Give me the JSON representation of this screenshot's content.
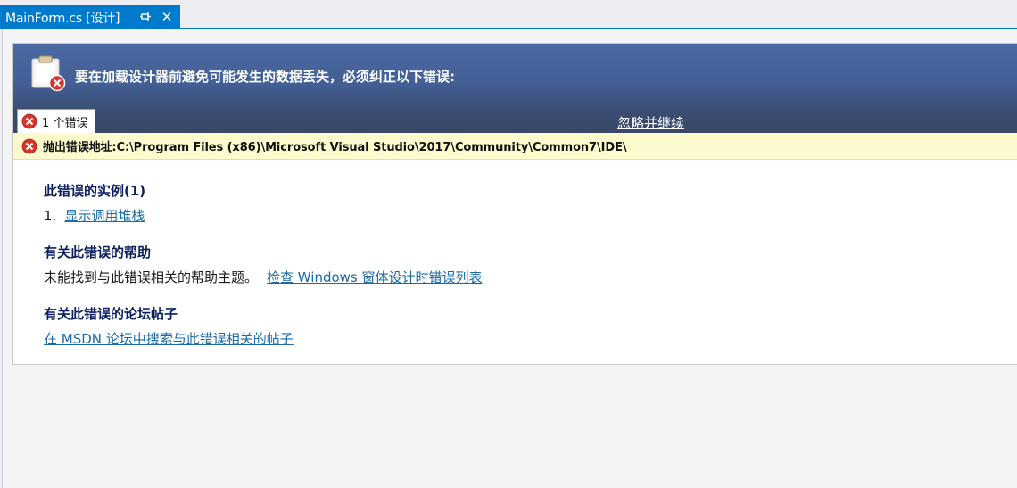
{
  "tab": {
    "title": "MainForm.cs [设计]",
    "pin_icon": "pin-icon",
    "close_label": "✕"
  },
  "header": {
    "message": "要在加载设计器前避免可能发生的数据丢失，必须纠正以下错误:",
    "icon": "clipboard-error-icon"
  },
  "error_tab": {
    "label": "1 个错误",
    "icon": "error-icon"
  },
  "ignore_link": "忽略并继续",
  "error_bar": {
    "text": "抛出错误地址:C:\\Program Files (x86)\\Microsoft Visual Studio\\2017\\Community\\Common7\\IDE\\",
    "icon": "error-icon"
  },
  "sections": {
    "instances": {
      "heading": "此错误的实例(1)",
      "number": "1.",
      "link": "显示调用堆栈"
    },
    "help": {
      "heading": "有关此错误的帮助",
      "text": "未能找到与此错误相关的帮助主题。",
      "link": "检查 Windows 窗体设计时错误列表"
    },
    "forum": {
      "heading": "有关此错误的论坛帖子",
      "link": "在 MSDN 论坛中搜索与此错误相关的帖子"
    }
  },
  "colors": {
    "accent": "#007acc",
    "header_top": "#4a69a2",
    "header_bottom": "#3a4866",
    "error_bar_bg": "#fdfacd",
    "heading": "#0b1f5e",
    "link": "#1a6aa8",
    "error_red": "#d9342b"
  }
}
